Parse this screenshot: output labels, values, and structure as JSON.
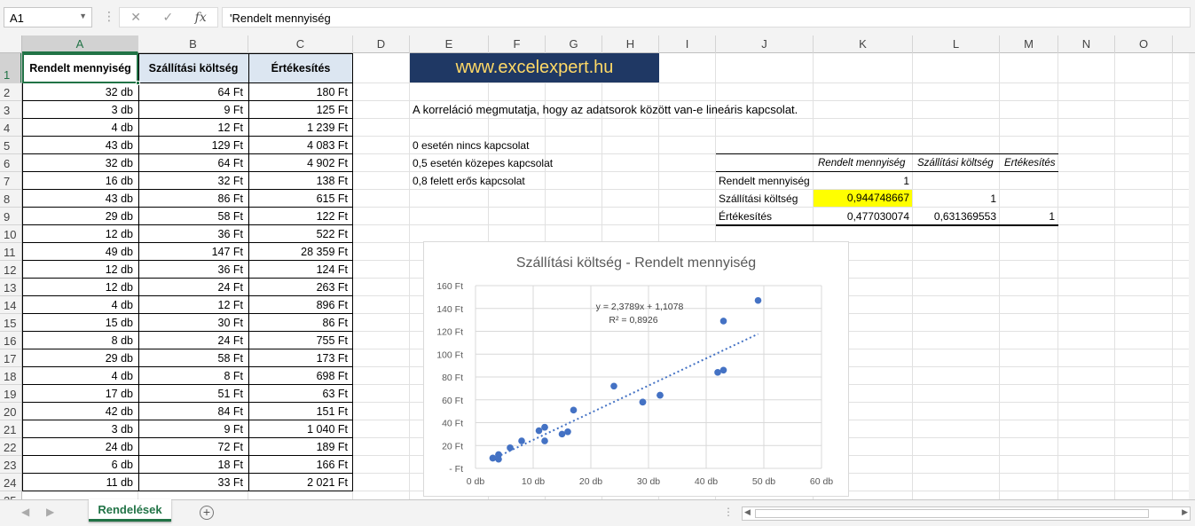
{
  "formula_bar": {
    "name_box": "A1",
    "formula": "'Rendelt mennyiség",
    "fx": "fx"
  },
  "columns": [
    "A",
    "B",
    "C",
    "D",
    "E",
    "F",
    "G",
    "H",
    "I",
    "J",
    "K",
    "L",
    "M",
    "N",
    "O"
  ],
  "rows": [
    "1",
    "2",
    "3",
    "4",
    "5",
    "6",
    "7",
    "8",
    "9",
    "10",
    "11",
    "12",
    "13",
    "14",
    "15",
    "16",
    "17",
    "18",
    "19",
    "20",
    "21",
    "22",
    "23",
    "24",
    "25"
  ],
  "table": {
    "headers": [
      "Rendelt mennyiség",
      "Szállítási költség",
      "Értékesítés"
    ],
    "rows": [
      [
        "32 db",
        "64 Ft",
        "180 Ft"
      ],
      [
        "3 db",
        "9 Ft",
        "125 Ft"
      ],
      [
        "4 db",
        "12 Ft",
        "1 239 Ft"
      ],
      [
        "43 db",
        "129 Ft",
        "4 083 Ft"
      ],
      [
        "32 db",
        "64 Ft",
        "4 902 Ft"
      ],
      [
        "16 db",
        "32 Ft",
        "138 Ft"
      ],
      [
        "43 db",
        "86 Ft",
        "615 Ft"
      ],
      [
        "29 db",
        "58 Ft",
        "122 Ft"
      ],
      [
        "12 db",
        "36 Ft",
        "522 Ft"
      ],
      [
        "49 db",
        "147 Ft",
        "28 359 Ft"
      ],
      [
        "12 db",
        "36 Ft",
        "124 Ft"
      ],
      [
        "12 db",
        "24 Ft",
        "263 Ft"
      ],
      [
        "4 db",
        "12 Ft",
        "896 Ft"
      ],
      [
        "15 db",
        "30 Ft",
        "86 Ft"
      ],
      [
        "8 db",
        "24 Ft",
        "755 Ft"
      ],
      [
        "29 db",
        "58 Ft",
        "173 Ft"
      ],
      [
        "4 db",
        "8 Ft",
        "698 Ft"
      ],
      [
        "17 db",
        "51 Ft",
        "63 Ft"
      ],
      [
        "42 db",
        "84 Ft",
        "151 Ft"
      ],
      [
        "3 db",
        "9 Ft",
        "1 040 Ft"
      ],
      [
        "24 db",
        "72 Ft",
        "189 Ft"
      ],
      [
        "6 db",
        "18 Ft",
        "166 Ft"
      ],
      [
        "11 db",
        "33 Ft",
        "2 021 Ft"
      ]
    ]
  },
  "banner": "www.excelexpert.hu",
  "description": "A korreláció megmutatja, hogy az adatsorok között van-e lineáris kapcsolat.",
  "notes": [
    "0 esetén nincs kapcsolat",
    "0,5 esetén közepes kapcsolat",
    "0,8 felett erős kapcsolat"
  ],
  "corr": {
    "headers": [
      "Rendelt mennyiség",
      "Szállítási költség",
      "Értékesítés"
    ],
    "rows": [
      {
        "label": "Rendelt mennyiség",
        "values": [
          "1",
          "",
          ""
        ]
      },
      {
        "label": "Szállítási költség",
        "values": [
          "0,944748667",
          "1",
          ""
        ]
      },
      {
        "label": "Értékesítés",
        "values": [
          "0,477030074",
          "0,631369553",
          "1"
        ]
      }
    ],
    "highlight_color": "#ffff00"
  },
  "chart_data": {
    "type": "scatter",
    "title": "Szállítási költség - Rendelt mennyiség",
    "xlim": [
      0,
      60
    ],
    "ylim": [
      0,
      160
    ],
    "x_ticks": [
      "0 db",
      "10 db",
      "20 db",
      "30 db",
      "40 db",
      "50 db",
      "60 db"
    ],
    "y_ticks": [
      "- Ft",
      "20 Ft",
      "40 Ft",
      "60 Ft",
      "80 Ft",
      "100 Ft",
      "120 Ft",
      "140 Ft",
      "160 Ft"
    ],
    "x_tick_values": [
      0,
      10,
      20,
      30,
      40,
      50,
      60
    ],
    "y_tick_values": [
      0,
      20,
      40,
      60,
      80,
      100,
      120,
      140,
      160
    ],
    "points": [
      [
        32,
        64
      ],
      [
        3,
        9
      ],
      [
        4,
        12
      ],
      [
        43,
        129
      ],
      [
        32,
        64
      ],
      [
        16,
        32
      ],
      [
        43,
        86
      ],
      [
        29,
        58
      ],
      [
        12,
        36
      ],
      [
        49,
        147
      ],
      [
        12,
        36
      ],
      [
        12,
        24
      ],
      [
        4,
        12
      ],
      [
        15,
        30
      ],
      [
        8,
        24
      ],
      [
        29,
        58
      ],
      [
        4,
        8
      ],
      [
        17,
        51
      ],
      [
        42,
        84
      ],
      [
        3,
        9
      ],
      [
        24,
        72
      ],
      [
        6,
        18
      ],
      [
        11,
        33
      ]
    ],
    "trendline": {
      "slope": 2.3789,
      "intercept": 1.1078,
      "x_range": [
        3,
        49
      ]
    },
    "equation": "y = 2,3789x + 1,1078",
    "r2": "R² = 0,8926",
    "color": "#4472c4",
    "grid": true
  },
  "sheet_tab": "Rendelések",
  "accent": "#217346"
}
